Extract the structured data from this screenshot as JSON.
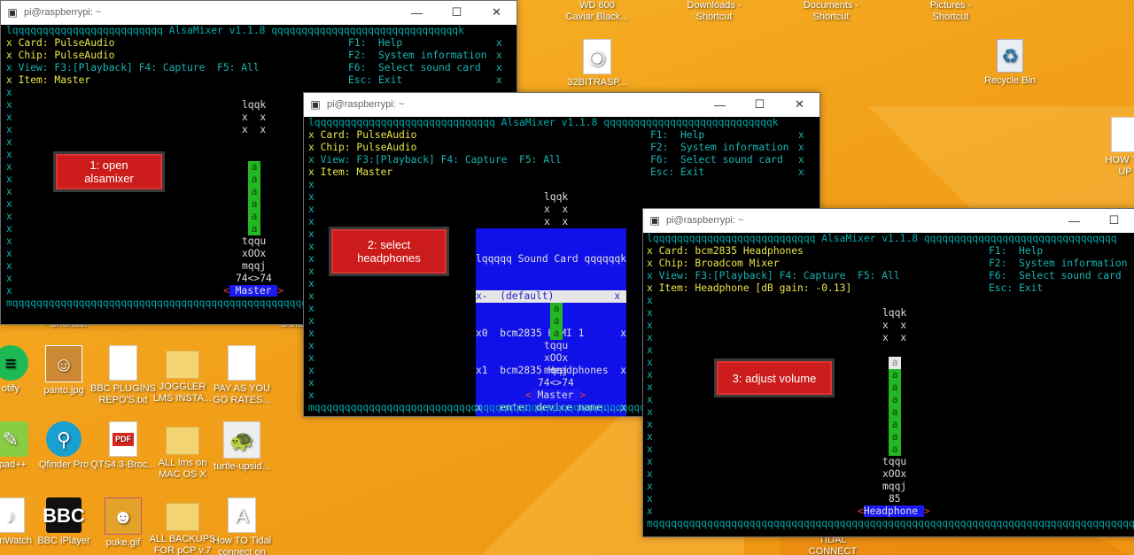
{
  "desktop_icons": [
    {
      "id": "wd600",
      "label": "WD 600\nCaviar Black...",
      "icon": "drive-icon"
    },
    {
      "id": "downloads",
      "label": "Downloads -\nShortcut",
      "icon": "folder-icon"
    },
    {
      "id": "documents",
      "label": "Documents -\nShortcut",
      "icon": "folder-icon"
    },
    {
      "id": "pictures",
      "label": "Pictures -\nShortcut",
      "icon": "folder-icon"
    },
    {
      "id": "rasp32",
      "label": "32BITRASP...",
      "icon": "file-icon"
    },
    {
      "id": "recycle",
      "label": "Recycle Bin",
      "icon": "recycle-bin-icon"
    },
    {
      "id": "howto",
      "label": "HOW TO\nUP",
      "icon": "file-icon"
    },
    {
      "id": "shortcut1",
      "label": "- Shortcut",
      "icon": "shortcut-icon"
    },
    {
      "id": "build",
      "label": "BUILD",
      "icon": "file-icon"
    },
    {
      "id": "spotify",
      "label": "otify",
      "icon": "spotify-icon"
    },
    {
      "id": "panto",
      "label": "panto.jpg",
      "icon": "image-icon"
    },
    {
      "id": "bbcplugins",
      "label": "BBC PLUGINS\nREPO'S.txt",
      "icon": "file-icon"
    },
    {
      "id": "joggler",
      "label": "JOGGLER\nLMS INSTA...",
      "icon": "folder-icon"
    },
    {
      "id": "payasyougo",
      "label": "PAY AS YOU\nGO RATES...",
      "icon": "file-icon"
    },
    {
      "id": "notepadpp",
      "label": "pad++",
      "icon": "notepad-icon"
    },
    {
      "id": "qfinder",
      "label": "Qfinder Pro",
      "icon": "search-icon"
    },
    {
      "id": "qts",
      "label": "QTS4.3-Broc...",
      "icon": "pdf-icon"
    },
    {
      "id": "alllms",
      "label": "ALL lms on\nMAC OS X",
      "icon": "folder-icon"
    },
    {
      "id": "turtle",
      "label": "turtle-upsid...",
      "icon": "image-icon"
    },
    {
      "id": "nwatch",
      "label": "nWatch",
      "icon": "music-icon"
    },
    {
      "id": "bbciplayer",
      "label": "BBC iPlayer",
      "icon": "bbc-iplayer-icon"
    },
    {
      "id": "puke",
      "label": "puke.gif",
      "icon": "image-icon"
    },
    {
      "id": "allbackups",
      "label": "ALL BACKUPS\nFOR pCP v.7",
      "icon": "folder-icon"
    },
    {
      "id": "howtotidal",
      "label": "How TO Tidal\nconnect on",
      "icon": "file-icon"
    },
    {
      "id": "tidal",
      "label": "TIDAL\nCONNECT",
      "icon": "file-icon"
    }
  ],
  "windows": [
    {
      "title": "pi@raspberrypi: ~",
      "header_line": "lqqqqqqqqqqqqqqqqqqqqqqqqq AlsaMixer v1.1.8 qqqqqqqqqqqqqqqqqqqqqqqqqqqqqqqk",
      "info": {
        "card": "x Card: PulseAudio",
        "chip": "x Chip: PulseAudio",
        "view": "x View: F3:[Playback] F4: Capture  F5: All",
        "item": "x Item: Master",
        "f1": "F1:  Help",
        "f2": "F2:  System information",
        "f6": "F6:  Select sound card",
        "esc": "Esc: Exit"
      },
      "level_text": "74<>74",
      "control_label": "Master",
      "volume_percent": 74
    },
    {
      "title": "pi@raspberrypi: ~",
      "header_line": "lqqqqqqqqqqqqqqqqqqqqqqqqqqqqqq AlsaMixer v1.1.8 qqqqqqqqqqqqqqqqqqqqqqqqqqqqk",
      "info": {
        "card": "x Card: PulseAudio",
        "chip": "x Chip: PulseAudio",
        "view": "x View: F3:[Playback] F4: Capture  F5: All",
        "item": "x Item: Master",
        "f1": "F1:  Help",
        "f2": "F2:  System information",
        "f6": "F6:  Select sound card",
        "esc": "Esc: Exit"
      },
      "popup": {
        "title": "lqqqqq Sound Card qqqqqqk",
        "rows": [
          "x-  (default)          x",
          "x0  bcm2835 HDMI 1      x",
          "x1  bcm2835 Headphones  x",
          "x   enter device name...x"
        ],
        "bottom": "mqqqqqqqqqqqqqqqqqqqqqqj",
        "selected_index": 0
      },
      "level_text": "74<>74",
      "control_label": "Master"
    },
    {
      "title": "pi@raspberrypi: ~",
      "header_line": "lqqqqqqqqqqqqqqqqqqqqqqqqqqq AlsaMixer v1.1.8 qqqqqqqqqqqqqqqqqqqqqqqqqqqqqqqq",
      "info": {
        "card": "x Card: bcm2835 Headphones",
        "chip": "x Chip: Broadcom Mixer",
        "view": "x View: F3:[Playback] F4: Capture  F5: All",
        "item": "x Item: Headphone [dB gain: -0.13]",
        "f1": "F1:  Help",
        "f2": "F2:  System information",
        "f6": "F6:  Select sound card",
        "esc": "Esc: Exit"
      },
      "level_text": "85",
      "control_label": "Headphone",
      "volume_percent": 85
    }
  ],
  "notes": [
    "1: open\nalsamixer",
    "2: select\nheadphones",
    "3: adjust volume"
  ],
  "mixer_glyphs": {
    "top": "lqqk",
    "side": "x  x",
    "tee": "tqqu",
    "oo": "xOOx",
    "bottom": "mqqj",
    "border_left": "x",
    "footer": "mqqqqqqqqqqqqqqqqqqqqqqqqqqqqqqqqqqqqqqqqqqqqqqqqqqqqqqqqqqqqqqqqqqqqqqqqqqqqqqqqqqqqqqq"
  },
  "controls": {
    "minimize": "—",
    "maximize": "☐",
    "close": "✕"
  }
}
